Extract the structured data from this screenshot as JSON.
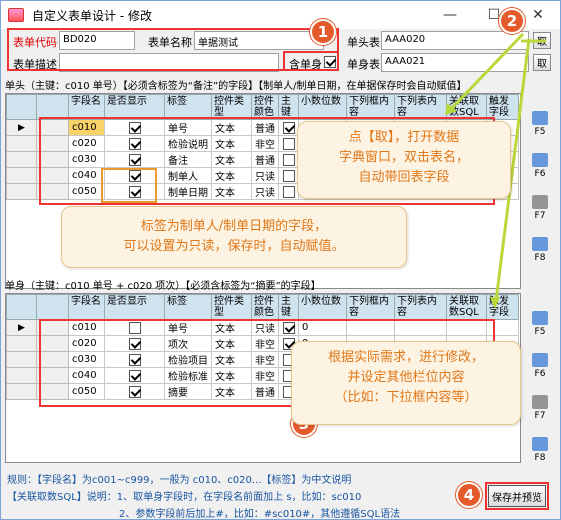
{
  "window": {
    "title": "自定义表单设计 - 修改",
    "min": "—",
    "max": "☐",
    "close": "✕"
  },
  "form": {
    "code_label": "表单代码",
    "code_value": "BD020",
    "name_label": "表单名称",
    "name_value": "单据测试",
    "desc_label": "表单描述",
    "desc_value": "",
    "has_body_label": "含单身",
    "head_table_label": "单头表",
    "head_table_value": "AAA020",
    "body_table_label": "单身表",
    "body_table_value": "AAA021",
    "get_btn": "取"
  },
  "head_section_title": "单头（主键：c010 单号）【必须含标签为“备注”的字段】【制单人/制单日期，在单据保存时会自动赋值】",
  "body_section_title": "单身（主键：c010 单号 + c020 项次）【必须含标签为“摘要”的字段】",
  "columns": [
    "字段名",
    "是否显示",
    "标签",
    "控件类型",
    "控件颜色",
    "主键",
    "小数位数",
    "下列框内容",
    "下列表内容",
    "关联取数SQL",
    "触发字段"
  ],
  "head_rows": [
    {
      "field": "c010",
      "show": true,
      "label": "单号",
      "type": "文本",
      "color": "普通",
      "pk": true,
      "dec": "0"
    },
    {
      "field": "c020",
      "show": true,
      "label": "检验说明",
      "type": "文本",
      "color": "非空",
      "pk": false,
      "dec": "0"
    },
    {
      "field": "c030",
      "show": true,
      "label": "备注",
      "type": "文本",
      "color": "普通",
      "pk": false,
      "dec": "0"
    },
    {
      "field": "c040",
      "show": true,
      "label": "制单人",
      "type": "文本",
      "color": "只读",
      "pk": false,
      "dec": "0"
    },
    {
      "field": "c050",
      "show": true,
      "label": "制单日期",
      "type": "文本",
      "color": "只读",
      "pk": false,
      "dec": "0"
    }
  ],
  "body_rows": [
    {
      "field": "c010",
      "show": false,
      "label": "单号",
      "type": "文本",
      "color": "只读",
      "pk": true,
      "dec": "0"
    },
    {
      "field": "c020",
      "show": true,
      "label": "项次",
      "type": "文本",
      "color": "非空",
      "pk": true,
      "dec": "0"
    },
    {
      "field": "c030",
      "show": true,
      "label": "检验项目",
      "type": "文本",
      "color": "非空",
      "pk": false,
      "dec": "0"
    },
    {
      "field": "c040",
      "show": true,
      "label": "检验标准",
      "type": "文本",
      "color": "非空",
      "pk": false,
      "dec": "0"
    },
    {
      "field": "c050",
      "show": true,
      "label": "摘要",
      "type": "文本",
      "color": "普通",
      "pk": false,
      "dec": "0"
    }
  ],
  "side_buttons_top": [
    "F5",
    "F6",
    "F7",
    "F8"
  ],
  "side_buttons_bottom": [
    "F5",
    "F6",
    "F7",
    "F8"
  ],
  "footer": {
    "line1": "规则：【字段名】为c001~c999，一般为 c010、c020...【标签】为中文说明",
    "line2": "【关联取数SQL】说明：1、取单身字段时，在字段名前面加上 s，比如：sc010",
    "line3": "2、参数字段前后加上#，比如：#sc010#，其他遵循SQL语法"
  },
  "save_button": "保存并预览",
  "badges": [
    "1",
    "2",
    "3",
    "4"
  ],
  "callouts": {
    "get": [
      "点【取】，打开数据",
      "字典窗口，双击表名，",
      "自动带回表字段"
    ],
    "readonly": [
      "标签为制单人/制单日期的字段，",
      "可以设置为只读，保存时，自动赋值。"
    ],
    "modify": [
      "根据实际需求，进行修改，",
      "并设定其他栏位内容",
      "（比如：下拉框内容等）"
    ]
  }
}
